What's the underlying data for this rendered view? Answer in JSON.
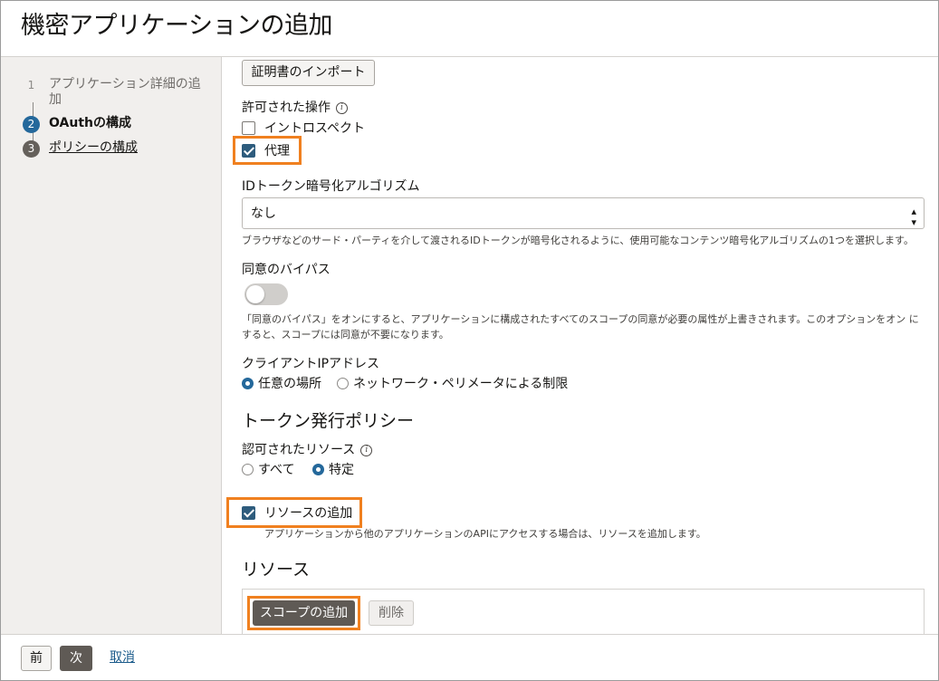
{
  "title": "機密アプリケーションの追加",
  "steps": [
    {
      "num": "1",
      "label": "アプリケーション詳細の追加"
    },
    {
      "num": "2",
      "label": "OAuthの構成"
    },
    {
      "num": "3",
      "label": "ポリシーの構成"
    }
  ],
  "main": {
    "import_cert_button": "証明書のインポート",
    "allowed_ops_label": "許可された操作",
    "introspect_label": "イントロスペクト",
    "proxy_label": "代理",
    "id_token_alg_label": "IDトークン暗号化アルゴリズム",
    "id_token_alg_value": "なし",
    "id_token_alg_help": "ブラウザなどのサード・パーティを介して渡されるIDトークンが暗号化されるように、使用可能なコンテンツ暗号化アルゴリズムの1つを選択します。",
    "consent_bypass_label": "同意のバイパス",
    "consent_bypass_help_1": "「同意のバイパス」をオンにすると、アプリケーションに構成されたすべてのスコープの同意が必要の属性が上書きされます。このオプションをオン に",
    "consent_bypass_help_2": "すると、スコープには同意が不要になります。",
    "client_ip_label": "クライアントIPアドレス",
    "client_ip_any": "任意の場所",
    "client_ip_perimeter": "ネットワーク・ペリメータによる制限",
    "token_policy_heading": "トークン発行ポリシー",
    "authorized_resources_label": "認可されたリソース",
    "res_all": "すべて",
    "res_specific": "特定",
    "add_resources_label": "リソースの追加",
    "add_resources_help": "アプリケーションから他のアプリケーションのAPIにアクセスする場合は、リソースを追加します。",
    "resources_heading": "リソース",
    "add_scope_button": "スコープの追加",
    "delete_button": "削除"
  },
  "footer": {
    "prev": "前",
    "next": "次",
    "cancel": "取消"
  },
  "colors": {
    "highlight": "#f0801f",
    "primary_dark": "#5f5a55",
    "step_current": "#24689b"
  }
}
